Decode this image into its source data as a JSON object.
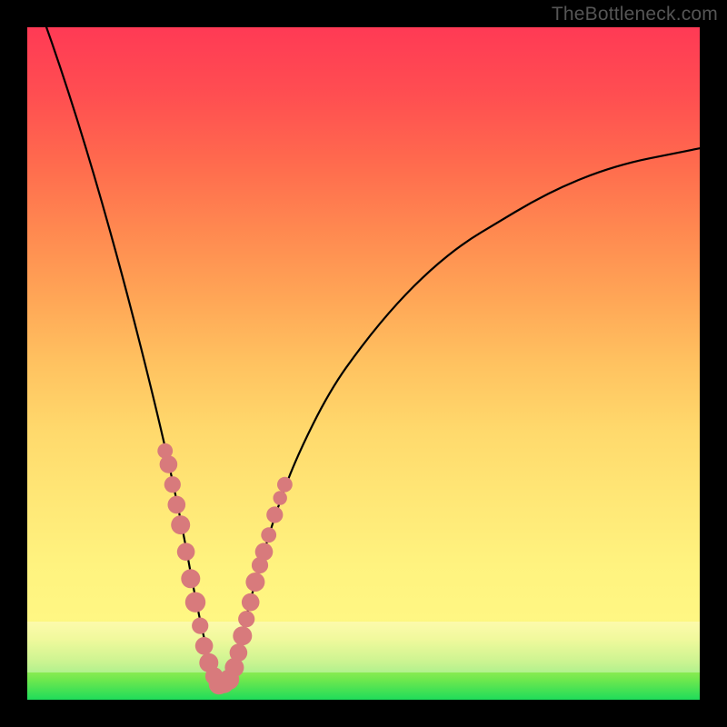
{
  "watermark": {
    "text": "TheBottleneck.com"
  },
  "colors": {
    "curve_stroke": "#000000",
    "marker_fill": "#d87a7c",
    "marker_stroke": "#c46466",
    "background_black": "#000000"
  },
  "chart_data": {
    "type": "line",
    "title": "",
    "xlabel": "",
    "ylabel": "",
    "xlim": [
      0,
      100
    ],
    "ylim": [
      0,
      100
    ],
    "grid": false,
    "legend": false,
    "series": [
      {
        "name": "bottleneck-curve",
        "x": [
          0,
          5,
          10,
          15,
          20,
          23,
          25,
          27,
          28.5,
          30,
          32,
          34,
          37,
          40,
          45,
          50,
          55,
          60,
          65,
          70,
          75,
          80,
          85,
          90,
          95,
          100
        ],
        "y": [
          108,
          94,
          78,
          60,
          40,
          26,
          15,
          6,
          2,
          3,
          10,
          18,
          28,
          36,
          46,
          53,
          59,
          64,
          68,
          71,
          74,
          76.5,
          78.5,
          80,
          81,
          82
        ]
      }
    ],
    "markers_left": [
      {
        "x": 20.5,
        "y": 37,
        "r": 1.2
      },
      {
        "x": 21.0,
        "y": 35,
        "r": 1.4
      },
      {
        "x": 21.6,
        "y": 32,
        "r": 1.3
      },
      {
        "x": 22.2,
        "y": 29,
        "r": 1.4
      },
      {
        "x": 22.8,
        "y": 26,
        "r": 1.5
      },
      {
        "x": 23.6,
        "y": 22,
        "r": 1.4
      },
      {
        "x": 24.3,
        "y": 18,
        "r": 1.5
      },
      {
        "x": 25.0,
        "y": 14.5,
        "r": 1.6
      },
      {
        "x": 25.7,
        "y": 11,
        "r": 1.3
      },
      {
        "x": 26.3,
        "y": 8,
        "r": 1.4
      },
      {
        "x": 27.0,
        "y": 5.5,
        "r": 1.5
      },
      {
        "x": 27.8,
        "y": 3.5,
        "r": 1.4
      },
      {
        "x": 28.5,
        "y": 2.3,
        "r": 1.6
      },
      {
        "x": 29.3,
        "y": 2.4,
        "r": 1.5
      },
      {
        "x": 30.0,
        "y": 3.0,
        "r": 1.6
      }
    ],
    "markers_right": [
      {
        "x": 30.8,
        "y": 4.8,
        "r": 1.5
      },
      {
        "x": 31.4,
        "y": 7.0,
        "r": 1.4
      },
      {
        "x": 32.0,
        "y": 9.5,
        "r": 1.5
      },
      {
        "x": 32.6,
        "y": 12,
        "r": 1.3
      },
      {
        "x": 33.2,
        "y": 14.5,
        "r": 1.4
      },
      {
        "x": 33.9,
        "y": 17.5,
        "r": 1.5
      },
      {
        "x": 34.6,
        "y": 20,
        "r": 1.3
      },
      {
        "x": 35.2,
        "y": 22,
        "r": 1.4
      },
      {
        "x": 35.9,
        "y": 24.5,
        "r": 1.2
      },
      {
        "x": 36.8,
        "y": 27.5,
        "r": 1.3
      },
      {
        "x": 37.6,
        "y": 30,
        "r": 1.1
      },
      {
        "x": 38.3,
        "y": 32,
        "r": 1.2
      }
    ]
  }
}
